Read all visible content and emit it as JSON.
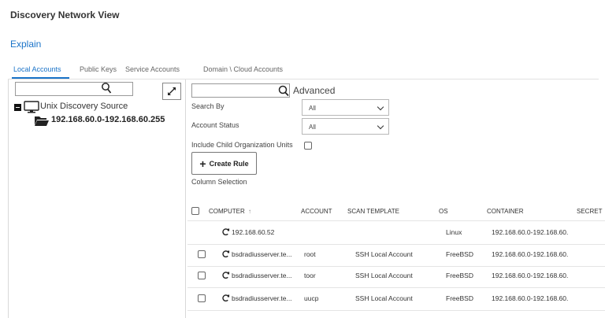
{
  "page": {
    "title": "Discovery Network View",
    "explain_link": "Explain"
  },
  "tabs": [
    {
      "label": "Local Accounts",
      "active": true
    },
    {
      "label": "Public Keys",
      "active": false
    },
    {
      "label": "Service Accounts",
      "active": false
    },
    {
      "label": "Domain \\ Cloud Accounts",
      "active": false
    }
  ],
  "tree": {
    "search_placeholder": "",
    "root": {
      "label": "Unix Discovery Source",
      "icon": "monitor-icon"
    },
    "child": {
      "label": "192.168.60.0-192.168.60.255",
      "icon": "folder-open-icon"
    }
  },
  "filters": {
    "search_placeholder": "",
    "advanced_label": "Advanced",
    "search_by": {
      "label": "Search By",
      "value": "All"
    },
    "account_status": {
      "label": "Account Status",
      "value": "All"
    },
    "include_child": {
      "label": "Include Child Organization Units",
      "checked": false
    },
    "create_rule_label": "Create Rule",
    "column_selection_label": "Column Selection"
  },
  "grid": {
    "columns": [
      "COMPUTER",
      "ACCOUNT",
      "SCAN TEMPLATE",
      "OS",
      "CONTAINER",
      "SECRET"
    ],
    "sort_indicator": "↑",
    "rows": [
      {
        "computer": "192.168.60.52",
        "account": "",
        "scan_template": "",
        "os": "Linux",
        "container": "192.168.60.0-192.168.60.",
        "has_checkbox": false
      },
      {
        "computer": "bsdradiusserver.te...",
        "account": "root",
        "scan_template": "SSH Local Account",
        "os": "FreeBSD",
        "container": "192.168.60.0-192.168.60.",
        "has_checkbox": true
      },
      {
        "computer": "bsdradiusserver.te...",
        "account": "toor",
        "scan_template": "SSH Local Account",
        "os": "FreeBSD",
        "container": "192.168.60.0-192.168.60.",
        "has_checkbox": true
      },
      {
        "computer": "bsdradiusserver.te...",
        "account": "uucp",
        "scan_template": "SSH Local Account",
        "os": "FreeBSD",
        "container": "192.168.60.0-192.168.60.",
        "has_checkbox": true
      }
    ]
  },
  "colors": {
    "accent": "#1a73c8",
    "text": "#333333",
    "border": "#d8d8d8"
  }
}
